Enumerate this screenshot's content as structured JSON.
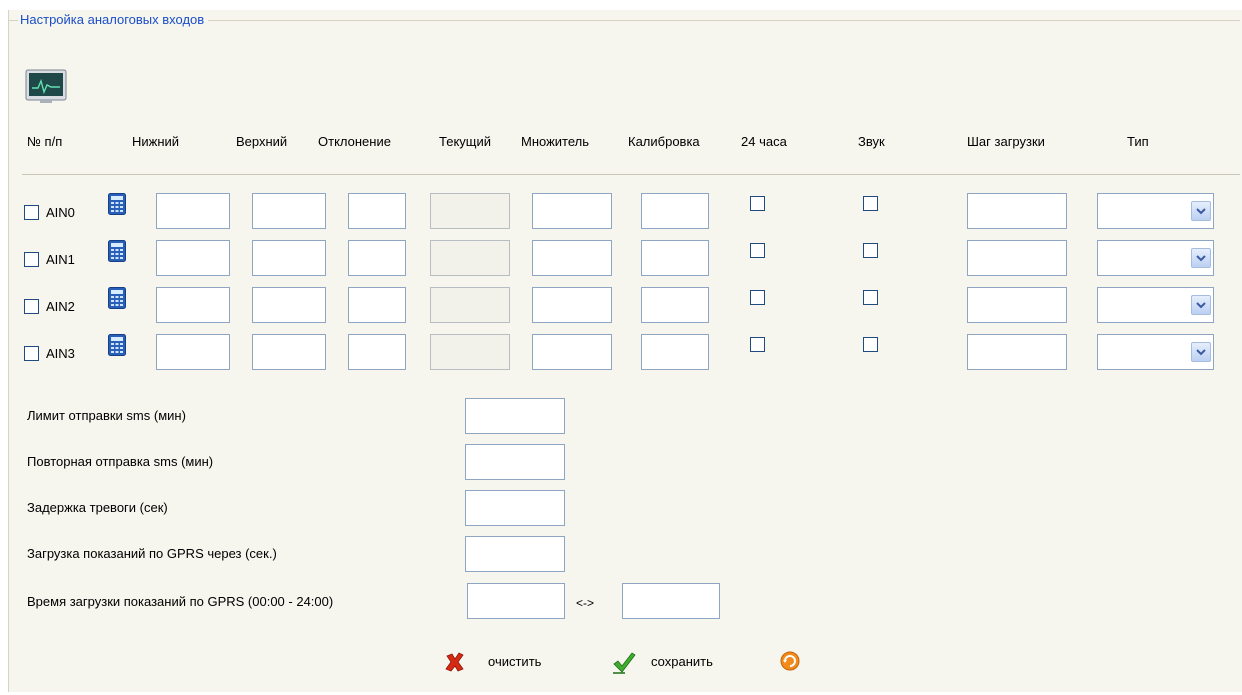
{
  "panel": {
    "title": "Настройка аналоговых входов"
  },
  "toolbar": {
    "monitor_icon": "monitor-chart-icon"
  },
  "columns": {
    "num": "№ п/п",
    "lower": "Нижний",
    "upper": "Верхний",
    "deviation": "Отклонение",
    "current": "Текущий",
    "multiplier": "Множитель",
    "calibration": "Калибровка",
    "h24": "24 часа",
    "sound": "Звук",
    "load_step": "Шаг загрузки",
    "type": "Тип"
  },
  "inputs": [
    {
      "label": "AIN0"
    },
    {
      "label": "AIN1"
    },
    {
      "label": "AIN2"
    },
    {
      "label": "AIN3"
    }
  ],
  "settings": {
    "sms_limit": "Лимит отправки sms (мин)",
    "sms_repeat": "Повторная отправка sms (мин)",
    "alarm_delay": "Задержка тревоги (сек)",
    "gprs_interval": "Загрузка показаний по GPRS через (сек.)",
    "gprs_time": "Время загрузки показаний по GPRS (00:00 - 24:00)",
    "range_sep": "<->"
  },
  "actions": {
    "clear": "очистить",
    "save": "сохранить",
    "refresh_icon": "refresh-icon"
  },
  "colors": {
    "legend": "#1a4fc8",
    "panel_bg": "#f6f5ee",
    "input_border": "#8fa5c4"
  }
}
